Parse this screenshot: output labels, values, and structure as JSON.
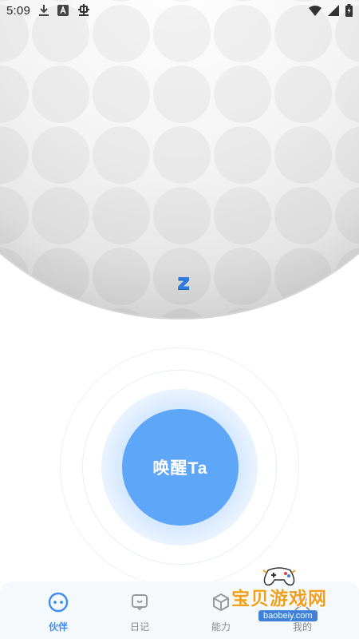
{
  "status_bar": {
    "time": "5:09",
    "left_icons": [
      "download-icon",
      "text-a-icon",
      "bug-icon"
    ],
    "right_icons": [
      "wifi-icon",
      "signal-icon",
      "battery-icon"
    ]
  },
  "pet": {
    "sleep_text": "z",
    "accent_color": "#2f7be0"
  },
  "wake": {
    "label": "唤醒Ta",
    "color": "#5ea6f8"
  },
  "nav": {
    "items": [
      {
        "label": "伙伴",
        "icon": "partner-icon",
        "active": true
      },
      {
        "label": "日记",
        "icon": "diary-icon",
        "active": false
      },
      {
        "label": "能力",
        "icon": "ability-icon",
        "active": false
      },
      {
        "label": "我的",
        "icon": "profile-icon",
        "active": false
      }
    ]
  },
  "watermark": {
    "title": "宝贝游戏网",
    "url": "baobeiy.com"
  }
}
